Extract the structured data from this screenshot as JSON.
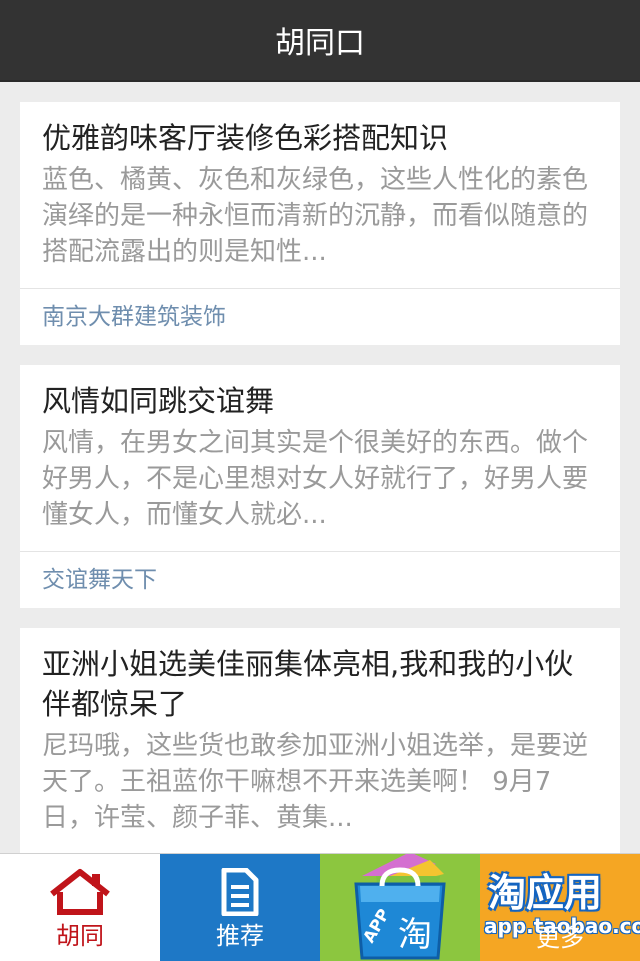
{
  "header": {
    "title": "胡同口"
  },
  "articles": [
    {
      "title": "优雅韵味客厅装修色彩搭配知识",
      "summary": "蓝色、橘黄、灰色和灰绿色，这些人性化的素色演绎的是一种永恒而清新的沉静，而看似随意的搭配流露出的则是知性...",
      "source": "南京大群建筑装饰"
    },
    {
      "title": "风情如同跳交谊舞",
      "summary": "风情，在男女之间其实是个很美好的东西。做个好男人，不是心里想对女人好就行了，好男人要懂女人，而懂女人就必...",
      "source": "交谊舞天下"
    },
    {
      "title": "亚洲小姐选美佳丽集体亮相,我和我的小伙伴都惊呆了",
      "summary": "尼玛哦，这些货也敢参加亚洲小姐选举，是要逆天了。王祖蓝你干嘛想不开来选美啊！ 9月7日，许莹、颜子菲、黄集...",
      "source": ""
    }
  ],
  "tabbar": {
    "tabs": [
      {
        "label": "胡同",
        "icon": "home-icon"
      },
      {
        "label": "推荐",
        "icon": "document-icon"
      },
      {
        "label": "",
        "icon": "shopping-bag-icon"
      },
      {
        "label": "更多",
        "icon": "more-icon"
      }
    ]
  },
  "banner": {
    "title": "淘应用",
    "url": "app.taobao.com",
    "bag_text": "APP",
    "bag_char": "淘"
  },
  "colors": {
    "topbar": "#333333",
    "active_tab": "#c0141a",
    "source_link": "#6f8eae"
  }
}
